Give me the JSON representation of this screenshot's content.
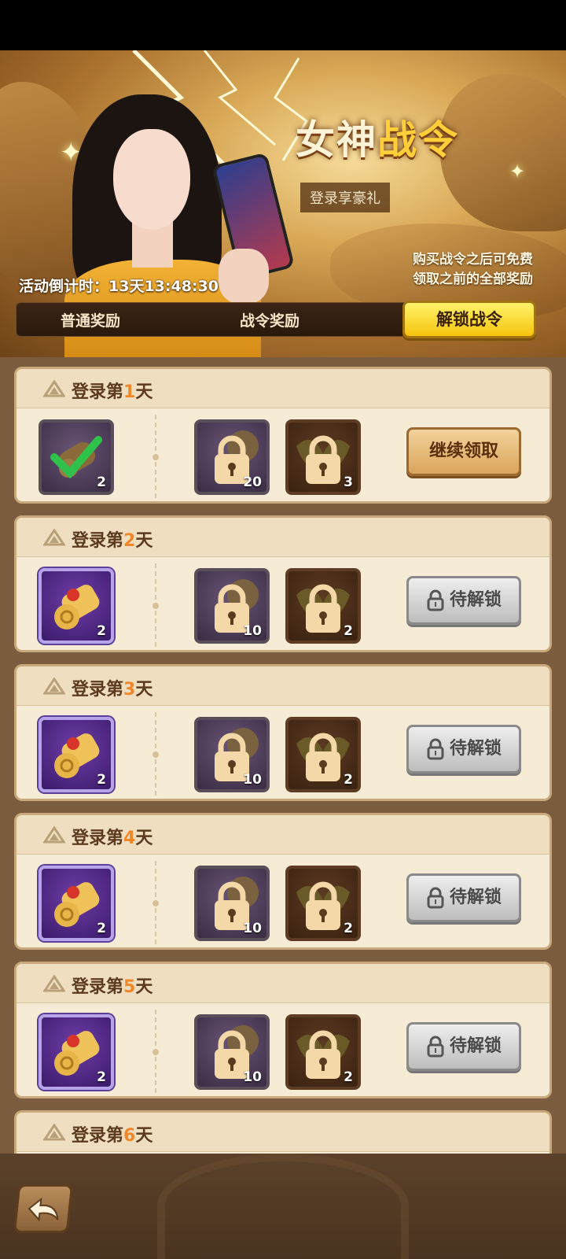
{
  "banner": {
    "title_main": "女神",
    "title_accent": "战令",
    "subtitle": "登录享豪礼",
    "buy_note_line1": "购买战令之后可免费",
    "buy_note_line2": "领取之前的全部奖励",
    "countdown_label": "活动倒计时：",
    "countdown_value": "13天13:48:30"
  },
  "tabs": {
    "normal": "普通奖励",
    "pass": "战令奖励",
    "unlock_button": "解锁战令"
  },
  "days": [
    {
      "prefix": "登录第",
      "num": "1",
      "suffix": "天",
      "normal_qty": "2",
      "pass1_qty": "20",
      "pass2_qty": "3",
      "button": "继续领取",
      "claimed": true
    },
    {
      "prefix": "登录第",
      "num": "2",
      "suffix": "天",
      "normal_qty": "2",
      "pass1_qty": "10",
      "pass2_qty": "2",
      "button": "待解锁",
      "claimed": false
    },
    {
      "prefix": "登录第",
      "num": "3",
      "suffix": "天",
      "normal_qty": "2",
      "pass1_qty": "10",
      "pass2_qty": "2",
      "button": "待解锁",
      "claimed": false
    },
    {
      "prefix": "登录第",
      "num": "4",
      "suffix": "天",
      "normal_qty": "2",
      "pass1_qty": "10",
      "pass2_qty": "2",
      "button": "待解锁",
      "claimed": false
    },
    {
      "prefix": "登录第",
      "num": "5",
      "suffix": "天",
      "normal_qty": "2",
      "pass1_qty": "10",
      "pass2_qty": "2",
      "button": "待解锁",
      "claimed": false
    },
    {
      "prefix": "登录第",
      "num": "6",
      "suffix": "天"
    }
  ],
  "icons": {
    "back": "back-arrow-icon",
    "lock": "lock-icon",
    "check": "checkmark-icon",
    "scroll": "scroll-icon"
  },
  "colors": {
    "accent_orange": "#f0882a",
    "unlock_yellow": "#f6c40d",
    "card_bg": "#f6ecd5",
    "page_bg": "#7c5c3e"
  }
}
